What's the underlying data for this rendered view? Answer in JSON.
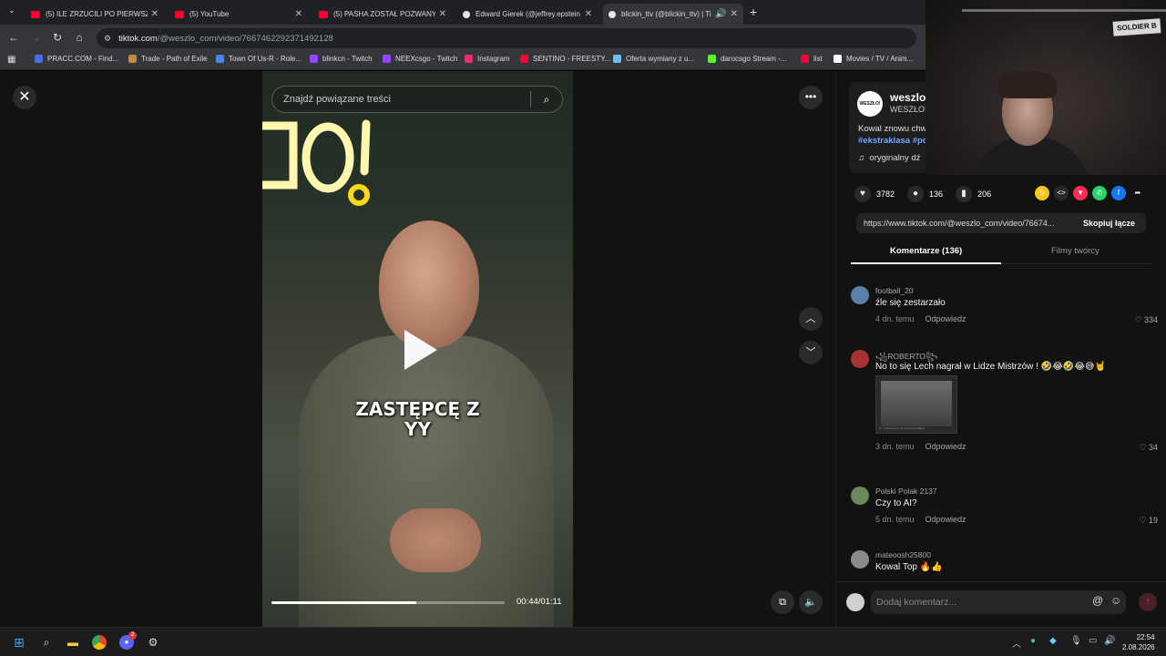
{
  "browser": {
    "tabs": [
      {
        "label": "(5) ILE ZRZUCILI PO PIERWSZYM",
        "favicon": "youtube-icon"
      },
      {
        "label": "(5) YouTube",
        "favicon": "youtube-icon"
      },
      {
        "label": "(5) PASHA ZOSTAŁ POZWANY! |",
        "favicon": "youtube-icon"
      },
      {
        "label": "Edward Gierek (@jeffrey.epstein",
        "favicon": "tiktok-icon"
      },
      {
        "label": "blickin_ttv (@blickin_ttv) | Ti",
        "favicon": "tiktok-icon"
      }
    ],
    "url_host": "tiktok.com",
    "url_path": "/@weszlo_com/video/7667462292371492128",
    "bookmarks": [
      {
        "label": "PRACC.COM - Find...",
        "color": "#4a6ee0"
      },
      {
        "label": "Trade - Path of Exile",
        "color": "#c08a3e"
      },
      {
        "label": "Town Of Us-R - Role...",
        "color": "#4285f4"
      },
      {
        "label": "blinkcn - Twitch",
        "color": "#9146ff"
      },
      {
        "label": "NEEXcsgo - Twitch",
        "color": "#9146ff"
      },
      {
        "label": "Instagram",
        "color": "#e1306c"
      },
      {
        "label": "SENTINO - FREESTY...",
        "color": "#ff0033"
      },
      {
        "label": "Oferta wymiany z u...",
        "color": "#66c0f4"
      },
      {
        "label": "darocsgo Stream -...",
        "color": "#53fc18"
      },
      {
        "label": "list",
        "color": "#ff0033"
      },
      {
        "label": "Movies / TV / Anim...",
        "color": "#ffffff"
      }
    ]
  },
  "video": {
    "search_placeholder": "Znajdź powiązane treści",
    "caption_line1": "ZASTĘPCĘ Z",
    "caption_line2": "YY",
    "current_time": "00:44",
    "duration": "01:11",
    "time_display": "00:44/01:11",
    "progress_fraction": 0.62
  },
  "author": {
    "avatar_text": "WESZŁO!",
    "name": "weszlo",
    "subtitle": "WESZŁO!",
    "description": "Kowal znowu chw",
    "hashtags": "#ekstraklasa #po",
    "music": "oryginalny dź"
  },
  "actions": {
    "likes": "3782",
    "comments": "136",
    "saves": "206"
  },
  "link": {
    "url": "https://www.tiktok.com/@weszlo_com/video/76674...",
    "copy_label": "Skopiuj łącze"
  },
  "panel_tabs": {
    "comments_label": "Komentarze (136)",
    "creator_videos_label": "Filmy twórcy"
  },
  "comments": [
    {
      "user": "football_20",
      "text": "źle się zestarzało",
      "date": "4 dn. temu",
      "reply": "Odpowiedz",
      "likes": "334",
      "avatar_color": "#5b7fa8"
    },
    {
      "user": "꧁ROBERTO꧂",
      "text": "No to się Lech nagrał w Lidze Mistrzów ! 🤣😂🤣😂😅🤘",
      "date": "3 dn. temu",
      "reply": "Odpowiedz",
      "likes": "34",
      "avatar_color": "#a83232",
      "image_caption": "Oi i metal konisz na samym początku..."
    },
    {
      "user": "Polski Polak 2137",
      "text": "Czy to AI?",
      "date": "5 dn. temu",
      "reply": "Odpowiedz",
      "likes": "19",
      "avatar_color": "#6a8a5a"
    },
    {
      "user": "mateoosh25800",
      "text": "Kowal Top 🔥👍",
      "date": "",
      "reply": "",
      "likes": "",
      "avatar_color": "#8a8a8a"
    }
  ],
  "add_comment": {
    "placeholder": "Dodaj komentarz..."
  },
  "webcam": {
    "sign_text": "SOLDIER B"
  },
  "taskbar": {
    "time": "22:54",
    "date": "2.08.2026",
    "discord_badge": "2"
  }
}
